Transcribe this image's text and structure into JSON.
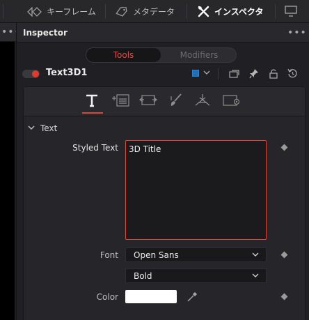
{
  "toolbar": {
    "keyframes_label": "キーフレーム",
    "metadata_label": "メタデータ",
    "inspector_label": "インスペクタ"
  },
  "inspector": {
    "title": "Inspector",
    "tabs": {
      "tools": "Tools",
      "modifiers": "Modifiers"
    },
    "node_name": "Text3D1",
    "node_color": "#1e6fb8",
    "accent_color": "#e0453a",
    "section": "Text",
    "fields": {
      "styled_text_label": "Styled Text",
      "styled_text_value": "3D Title",
      "font_label": "Font",
      "font_value": "Open Sans",
      "style_value": "Bold",
      "color_label": "Color",
      "color_value": "#ffffff"
    }
  }
}
